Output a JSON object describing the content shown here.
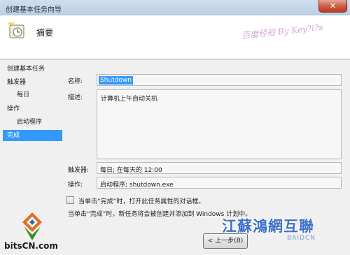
{
  "window": {
    "title": "创建基本任务向导",
    "close_label": "✕"
  },
  "header": {
    "title": "摘要",
    "watermark": "百度经验 By Key?i?s"
  },
  "nav": {
    "items": [
      {
        "label": "创建基本任务",
        "selected": false
      },
      {
        "label": "触发器",
        "selected": false
      },
      {
        "label": "每日",
        "selected": false
      },
      {
        "label": "操作",
        "selected": false
      },
      {
        "label": "启动程序",
        "selected": false
      },
      {
        "label": "完成",
        "selected": true
      }
    ]
  },
  "summary": {
    "name_label": "名称:",
    "name_value": "Shutdown",
    "desc_label": "描述:",
    "desc_value": "计算机上午自动关机",
    "trigger_label": "触发器:",
    "trigger_value": "每日; 在每天的 12:00",
    "action_label": "操作:",
    "action_value": "启动程序; shutdown.exe",
    "checkbox_label": "当单击“完成”时，打开此任务属性的对话框。",
    "checkbox_checked": false,
    "info_text": "当单击“完成”时，新任务将会被创建并添加到 Windows 计划中。"
  },
  "buttons": {
    "back_label": "< 上一步(B)"
  },
  "watermarks": {
    "bitscn": "bitsCN.com",
    "jiangsu": "江蘇鴻網互聯",
    "jiangsu_sub": "BAIDCN"
  },
  "colors": {
    "selection": "#3399ff",
    "window_frame": "#d7e3ee",
    "close_button": "#c75a43"
  }
}
